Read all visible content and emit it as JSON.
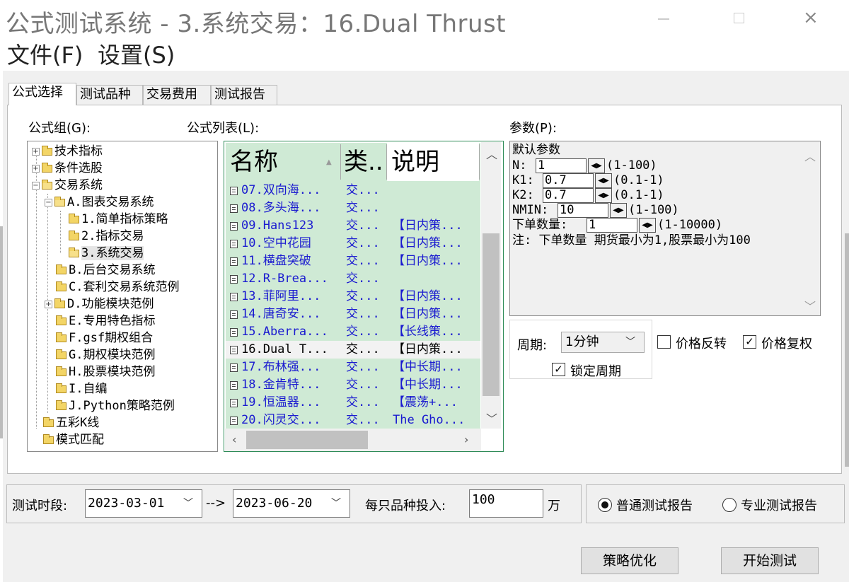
{
  "window": {
    "title": "公式测试系统 - 3.系统交易：16.Dual Thrust",
    "controls": {
      "minimize": "minimize-icon",
      "maximize": "maximize-icon",
      "close": "×"
    }
  },
  "menu": {
    "items": [
      "文件(F)",
      "设置(S)"
    ]
  },
  "tabs": [
    "公式选择",
    "测试品种",
    "交易费用",
    "测试报告"
  ],
  "formula_group": {
    "label": "公式组(G):",
    "tree": [
      {
        "label": "技术指标"
      },
      {
        "label": "条件选股"
      },
      {
        "label": "交易系统"
      },
      {
        "label": "A.图表交易系统"
      },
      {
        "label": "1.简单指标策略"
      },
      {
        "label": "2.指标交易"
      },
      {
        "label": "3.系统交易"
      },
      {
        "label": "B.后台交易系统"
      },
      {
        "label": "C.套利交易系统范例"
      },
      {
        "label": "D.功能模块范例"
      },
      {
        "label": "E.专用特色指标"
      },
      {
        "label": "F.gsf期权组合"
      },
      {
        "label": "G.期权模块范例"
      },
      {
        "label": "H.股票模块范例"
      },
      {
        "label": "I.自编"
      },
      {
        "label": "J.Python策略范例"
      },
      {
        "label": "五彩K线"
      },
      {
        "label": "模式匹配"
      }
    ]
  },
  "formula_list": {
    "label": "公式列表(L):",
    "columns": [
      "名称",
      "类..",
      "说明"
    ],
    "rows": [
      {
        "name": "07.双向海...",
        "type": "交...",
        "desc": ""
      },
      {
        "name": "08.多头海...",
        "type": "交...",
        "desc": ""
      },
      {
        "name": "09.Hans123",
        "type": "交...",
        "desc": "【日内策..."
      },
      {
        "name": "10.空中花园",
        "type": "交...",
        "desc": "【日内策..."
      },
      {
        "name": "11.横盘突破",
        "type": "交...",
        "desc": "【日内策..."
      },
      {
        "name": "12.R-Brea...",
        "type": "交...",
        "desc": ""
      },
      {
        "name": "13.菲阿里...",
        "type": "交...",
        "desc": "【日内策..."
      },
      {
        "name": "14.唐奇安...",
        "type": "交...",
        "desc": "【日内策..."
      },
      {
        "name": "15.Aberra...",
        "type": "交...",
        "desc": "【长线策..."
      },
      {
        "name": "16.Dual T...",
        "type": "交...",
        "desc": "【日内策..."
      },
      {
        "name": "17.布林强...",
        "type": "交...",
        "desc": "【中长期..."
      },
      {
        "name": "18.金肯特...",
        "type": "交...",
        "desc": "【中长期..."
      },
      {
        "name": "19.恒温器...",
        "type": "交...",
        "desc": "【震荡+..."
      },
      {
        "name": "20.闪灵交...",
        "type": "交...",
        "desc": "The Gho..."
      }
    ]
  },
  "params": {
    "label": "参数(P):",
    "title": "默认参数",
    "items": [
      {
        "name": "N:",
        "value": "1",
        "range": "(1-100)"
      },
      {
        "name": "K1:",
        "value": "0.7",
        "range": "(0.1-1)"
      },
      {
        "name": "K2:",
        "value": "0.7",
        "range": "(0.1-1)"
      },
      {
        "name": "NMIN:",
        "value": "10",
        "range": "(1-100)"
      },
      {
        "name": "下单数量:",
        "value": "1",
        "range": "(1-10000)"
      }
    ],
    "note": "注: 下单数量 期货最小为1,股票最小为100"
  },
  "period": {
    "label": "周期:",
    "value": "1分钟",
    "lock_label": "锁定周期",
    "lock_checked": true
  },
  "price_reverse": {
    "label": "价格反转",
    "checked": false
  },
  "price_adjust": {
    "label": "价格复权",
    "checked": true
  },
  "test_period": {
    "label": "测试时段:",
    "start": "2023-03-01",
    "arrow": "-->",
    "end": "2023-06-20"
  },
  "invest": {
    "label": "每只品种投入:",
    "value": "100",
    "unit": "万"
  },
  "report_type": {
    "normal": "普通测试报告",
    "pro": "专业测试报告",
    "selected": "normal"
  },
  "buttons": {
    "optimize": "策略优化",
    "start": "开始测试"
  }
}
